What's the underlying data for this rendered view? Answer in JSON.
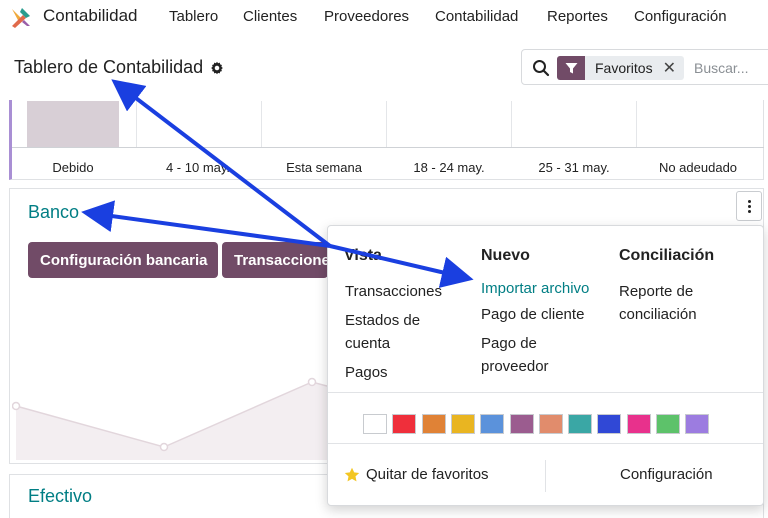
{
  "app": {
    "name": "Contabilidad"
  },
  "nav": {
    "items": [
      "Tablero",
      "Clientes",
      "Proveedores",
      "Contabilidad",
      "Reportes",
      "Configuración"
    ]
  },
  "control_panel": {
    "title": "Tablero de Contabilidad"
  },
  "search": {
    "facet_label": "Favoritos",
    "placeholder": "Buscar..."
  },
  "top_chart": {
    "x_labels": [
      "Debido",
      "4 - 10 may.",
      "Esta semana",
      "18 - 24 may.",
      "25 - 31 may.",
      "No adeudado"
    ]
  },
  "bank_card": {
    "title": "Banco",
    "buttons": [
      "Configuración bancaria",
      "Transacciones"
    ]
  },
  "cash_card": {
    "title": "Efectivo"
  },
  "dropdown": {
    "columns": [
      {
        "header": "Vista",
        "items": [
          "Transacciones",
          "Estados de cuenta",
          "Pagos"
        ]
      },
      {
        "header": "Nuevo",
        "items": [
          "Importar archivo",
          "Pago de cliente",
          "Pago de proveedor"
        ]
      },
      {
        "header": "Conciliación",
        "items": [
          "Reporte de conciliación"
        ]
      }
    ],
    "colors": [
      "#ffffff",
      "#ef2f3b",
      "#e08236",
      "#e9b521",
      "#5b92db",
      "#9b5c8f",
      "#e18c6c",
      "#3aa7a5",
      "#3048d6",
      "#e8318c",
      "#5dc26a",
      "#9c7ce0"
    ],
    "footer": {
      "unfavorite": "Quitar de favoritos",
      "settings": "Configuración"
    }
  },
  "theme": {
    "brand": "#714b67",
    "accent": "#017e84",
    "annotation_arrow": "#1a3fe0"
  }
}
